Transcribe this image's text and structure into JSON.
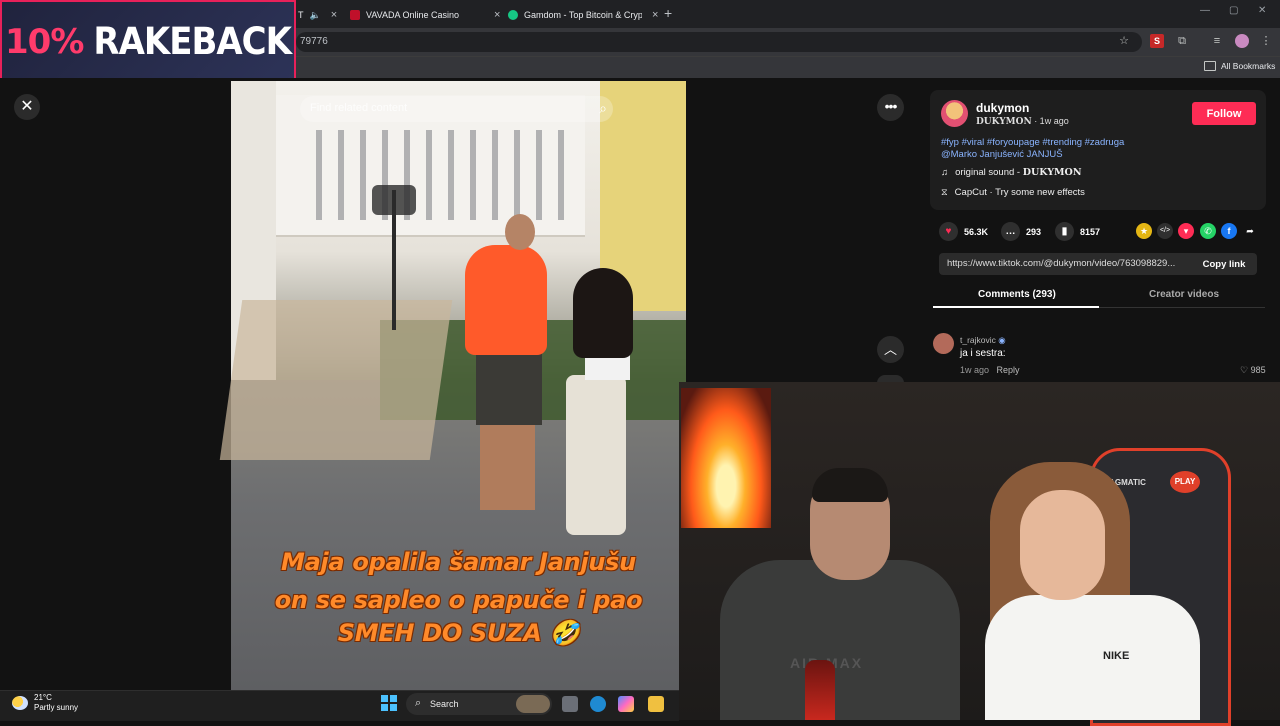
{
  "browser": {
    "tabs": [
      {
        "label": "VAVADA Online Casino",
        "close": "×"
      },
      {
        "label": "Gamdom - Top Bitcoin & Crypt",
        "close": "×"
      }
    ],
    "partial_tab_prefix": "T",
    "new_tab": "+",
    "window_controls": [
      "—",
      "▢",
      "✕"
    ],
    "url_fragment": "79776",
    "bookmarks_label": "All Bookmarks",
    "toolbar_icons": [
      "star-icon",
      "extension-s-icon",
      "puzzle-icon",
      "media-icon",
      "profile-icon",
      "menu-icon"
    ]
  },
  "overlay": {
    "pct": "10%",
    "word": "RAKEBACK"
  },
  "viewer": {
    "close": "✕",
    "search_placeholder": "Find related content",
    "more": "•••",
    "up": "︿",
    "caption_lines": [
      "Maja opalila šamar Janjušu",
      "on se sapleo o papuče i pao",
      "SMEH DO SUZA 🤣"
    ]
  },
  "post": {
    "username": "dukymon",
    "display_name": "DUKYMON",
    "time_ago": " · 1w ago",
    "follow_label": "Follow",
    "description_line1": "#fyp #viral #foryoupage #trending #zadruga",
    "description_line2": "@Marko Janjušević JANJUŠ",
    "sound_prefix": "original sound - ",
    "sound_author": "DUKYMON",
    "effect": "CapCut · Try some new effects",
    "likes": "56.3K",
    "comments": "293",
    "saves": "8157",
    "link": "https://www.tiktok.com/@dukymon/video/763098829...",
    "copy_link": "Copy link",
    "tab_comments": "Comments (293)",
    "tab_creator": "Creator videos"
  },
  "comment": {
    "user": "t_rajkovic",
    "text": "ja i sestra:",
    "time": "1w ago",
    "reply": "Reply",
    "likes": "985"
  },
  "webcam": {
    "chair_brand": "PRAGMATIC",
    "chair_play": "PLAY",
    "shirt_text": "AIR MAX",
    "woman_shirt": "NIKE"
  },
  "taskbar": {
    "temp": "21°C",
    "condition": "Partly sunny",
    "search_label": "Search"
  }
}
